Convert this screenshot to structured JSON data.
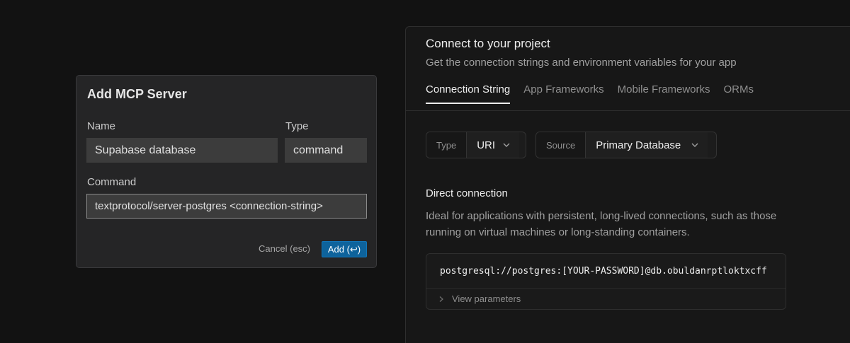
{
  "mcp_dialog": {
    "title": "Add MCP Server",
    "name_label": "Name",
    "name_value": "Supabase database",
    "type_label": "Type",
    "type_value": "command",
    "command_label": "Command",
    "command_value": "textprotocol/server-postgres <connection-string>",
    "cancel_label": "Cancel (esc)",
    "add_label": "Add (↩)"
  },
  "connect_panel": {
    "title": "Connect to your project",
    "subtitle": "Get the connection strings and environment variables for your app",
    "tabs": [
      {
        "label": "Connection String",
        "active": true
      },
      {
        "label": "App Frameworks",
        "active": false
      },
      {
        "label": "Mobile Frameworks",
        "active": false
      },
      {
        "label": "ORMs",
        "active": false
      }
    ],
    "type_selector": {
      "label": "Type",
      "value": "URI"
    },
    "source_selector": {
      "label": "Source",
      "value": "Primary Database"
    },
    "section_title": "Direct connection",
    "section_desc": "Ideal for applications with persistent, long-lived connections, such as those running on virtual machines or long-standing containers.",
    "connection_string": "postgresql://postgres:[YOUR-PASSWORD]@db.obuldanrptloktxcff",
    "view_parameters_label": "View parameters"
  },
  "icons": {
    "dropdown": "chevron-down-icon",
    "expand": "chevron-right-icon"
  }
}
